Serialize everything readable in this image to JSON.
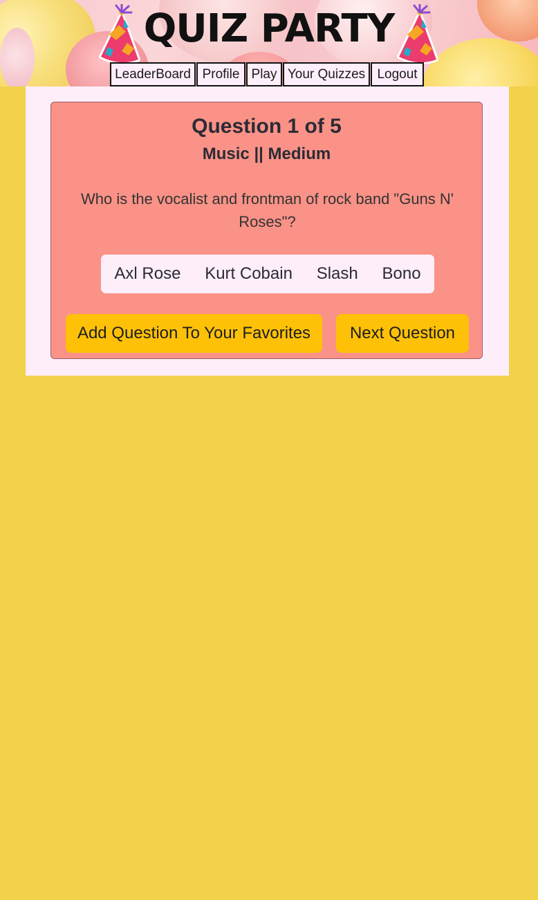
{
  "header": {
    "title": "QUIZ PARTY",
    "nav": [
      "LeaderBoard",
      "Profile",
      "Play",
      "Your Quizzes",
      "Logout"
    ]
  },
  "quiz": {
    "progress": "Question 1 of 5",
    "meta": "Music || Medium",
    "question": "Who is the vocalist and frontman of rock band \"Guns N' Roses\"?",
    "answers": [
      "Axl Rose",
      "Kurt Cobain",
      "Slash",
      "Bono"
    ],
    "favorite_label": "Add Question To Your Favorites",
    "next_label": "Next Question"
  },
  "colors": {
    "page_bg": "#f2d24a",
    "content_bg": "#fdeefa",
    "card_bg": "#fa9287",
    "button_bg": "#ffc107"
  },
  "icons": [
    "party-hat-icon",
    "party-hat-icon"
  ]
}
